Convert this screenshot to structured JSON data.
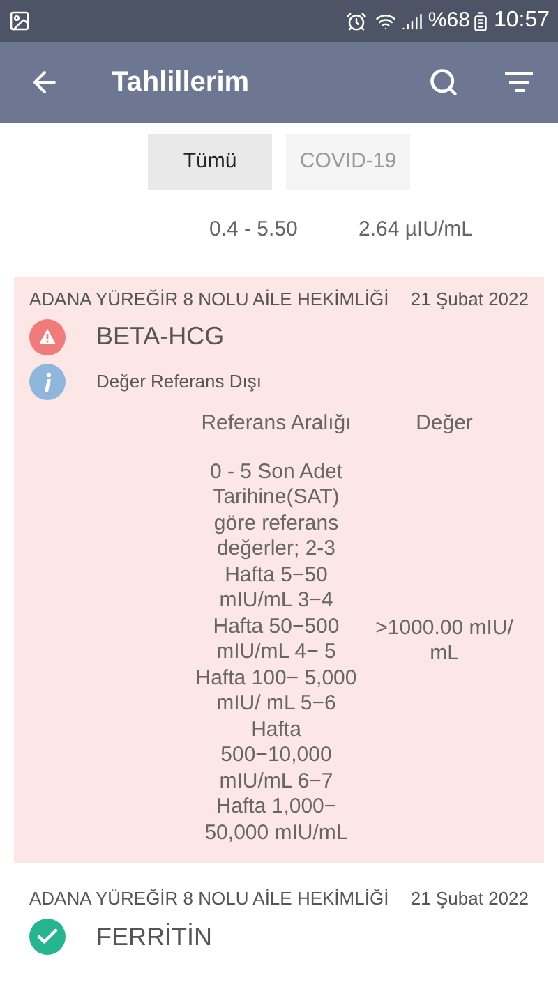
{
  "status_bar": {
    "battery": "%68",
    "time": "10:57"
  },
  "app_bar": {
    "title": "Tahlillerim"
  },
  "tabs": [
    {
      "label": "Tümü",
      "selected": true
    },
    {
      "label": "COVID-19",
      "selected": false
    }
  ],
  "previous_result": {
    "reference": "0.4 - 5.50",
    "value": "2.64 µIU/mL"
  },
  "results": [
    {
      "kind": "alert",
      "out_of_range": true,
      "institution": "ADANA YÜREĞİR 8 NOLU AİLE HEKİMLİĞİ",
      "date": "21 Şubat 2022",
      "test": "BETA-HCG",
      "note": "Değer Referans Dışı",
      "reference_heading": "Referans Aralığı",
      "value_heading": "Değer",
      "reference": "0 - 5  Son Adet Tarihine(SAT) göre referans değerler; 2-3 Hafta 5−50 mIU/mL 3−4 Hafta 50−500 mIU/mL 4− 5 Hafta 100− 5,000 mIU/ mL 5−6 Hafta 500−10,000 mIU/mL 6−7 Hafta 1,000− 50,000 mIU/mL",
      "value": ">1000.00 mIU/ mL"
    },
    {
      "kind": "ok",
      "out_of_range": false,
      "institution": "ADANA YÜREĞİR 8 NOLU AİLE HEKİMLİĞİ",
      "date": "21 Şubat 2022",
      "test": "FERRİTİN"
    }
  ]
}
